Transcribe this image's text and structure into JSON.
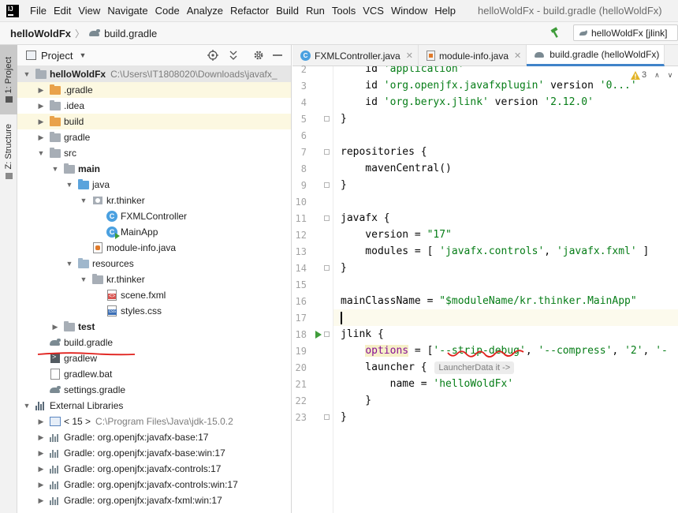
{
  "menubar": {
    "items": [
      "File",
      "Edit",
      "View",
      "Navigate",
      "Code",
      "Analyze",
      "Refactor",
      "Build",
      "Run",
      "Tools",
      "VCS",
      "Window",
      "Help"
    ],
    "window_title": "helloWoldFx - build.gradle (helloWoldFx)"
  },
  "navbar": {
    "project": "helloWoldFx",
    "file": "build.gradle",
    "run_config": "helloWoldFx [jlink]"
  },
  "toolstrip": {
    "project_tab": "1: Project",
    "structure_tab": "Z: Structure"
  },
  "project_panel": {
    "title": "Project",
    "tree": [
      {
        "label": "helloWoldFx",
        "path": "C:\\Users\\IT1808020\\Downloads\\javafx_",
        "icon": "folder-grey",
        "depth": 0,
        "open": true,
        "bold": true
      },
      {
        "label": ".gradle",
        "icon": "folder-orange",
        "depth": 1,
        "open": false
      },
      {
        "label": ".idea",
        "icon": "folder-grey",
        "depth": 1,
        "open": false
      },
      {
        "label": "build",
        "icon": "folder-orange",
        "depth": 1,
        "open": false
      },
      {
        "label": "gradle",
        "icon": "folder-grey",
        "depth": 1,
        "open": false
      },
      {
        "label": "src",
        "icon": "folder-grey",
        "depth": 1,
        "open": true
      },
      {
        "label": "main",
        "icon": "folder-grey",
        "depth": 2,
        "open": true,
        "bold": true
      },
      {
        "label": "java",
        "icon": "folder-blue",
        "depth": 3,
        "open": true
      },
      {
        "label": "kr.thinker",
        "icon": "package",
        "depth": 4,
        "open": true
      },
      {
        "label": "FXMLController",
        "icon": "class",
        "depth": 5,
        "leaf": true
      },
      {
        "label": "MainApp",
        "icon": "class-run",
        "depth": 5,
        "leaf": true
      },
      {
        "label": "module-info.java",
        "icon": "java-file",
        "depth": 4,
        "leaf": true
      },
      {
        "label": "resources",
        "icon": "folder-light",
        "depth": 3,
        "open": true
      },
      {
        "label": "kr.thinker",
        "icon": "folder-grey",
        "depth": 4,
        "open": true
      },
      {
        "label": "scene.fxml",
        "icon": "fxml-file",
        "depth": 5,
        "leaf": true
      },
      {
        "label": "styles.css",
        "icon": "css-file",
        "depth": 5,
        "leaf": true
      },
      {
        "label": "test",
        "icon": "folder-grey",
        "depth": 2,
        "open": false,
        "bold": true
      },
      {
        "label": "build.gradle",
        "icon": "gradle",
        "depth": 1,
        "leaf": true
      },
      {
        "label": "gradlew",
        "icon": "terminal",
        "depth": 1,
        "leaf": true
      },
      {
        "label": "gradlew.bat",
        "icon": "file",
        "depth": 1,
        "leaf": true
      },
      {
        "label": "settings.gradle",
        "icon": "gradle",
        "depth": 1,
        "leaf": true
      },
      {
        "label": "External Libraries",
        "icon": "bars",
        "depth": 0,
        "open": true
      },
      {
        "label": "< 15 >",
        "path": "C:\\Program Files\\Java\\jdk-15.0.2",
        "icon": "jdk",
        "depth": 1,
        "open": false
      },
      {
        "label": "Gradle: org.openjfx:javafx-base:17",
        "icon": "library",
        "depth": 1,
        "open": false
      },
      {
        "label": "Gradle: org.openjfx:javafx-base:win:17",
        "icon": "library",
        "depth": 1,
        "open": false
      },
      {
        "label": "Gradle: org.openjfx:javafx-controls:17",
        "icon": "library",
        "depth": 1,
        "open": false
      },
      {
        "label": "Gradle: org.openjfx:javafx-controls:win:17",
        "icon": "library",
        "depth": 1,
        "open": false
      },
      {
        "label": "Gradle: org.openjfx:javafx-fxml:win:17",
        "icon": "library",
        "depth": 1,
        "open": false
      }
    ]
  },
  "editor": {
    "tabs": [
      {
        "label": "FXMLController.java",
        "icon": "class"
      },
      {
        "label": "module-info.java",
        "icon": "java-file"
      },
      {
        "label": "build.gradle (helloWoldFx)",
        "icon": "gradle",
        "active": true
      }
    ],
    "warning_count": "3",
    "lines": [
      {
        "n": "2",
        "text": "    id 'application'"
      },
      {
        "n": "3",
        "text": "    id 'org.openjfx.javafxplugin' version '0...'"
      },
      {
        "n": "4",
        "text": "    id 'org.beryx.jlink' version '2.12.0'"
      },
      {
        "n": "5",
        "text": "}"
      },
      {
        "n": "6",
        "text": ""
      },
      {
        "n": "7",
        "text": "repositories {"
      },
      {
        "n": "8",
        "text": "    mavenCentral()"
      },
      {
        "n": "9",
        "text": "}"
      },
      {
        "n": "10",
        "text": ""
      },
      {
        "n": "11",
        "text": "javafx {"
      },
      {
        "n": "12",
        "text": "    version = \"17\""
      },
      {
        "n": "13",
        "text": "    modules = [ 'javafx.controls', 'javafx.fxml' ]"
      },
      {
        "n": "14",
        "text": "}"
      },
      {
        "n": "15",
        "text": ""
      },
      {
        "n": "16",
        "text": "mainClassName = \"$moduleName/kr.thinker.MainApp\""
      },
      {
        "n": "17",
        "text": ""
      },
      {
        "n": "18",
        "text": "jlink {"
      },
      {
        "n": "19",
        "text": "    options = ['--strip-debug', '--compress', '2', '-"
      },
      {
        "n": "20",
        "text": "    launcher {"
      },
      {
        "n": "21",
        "text": "        name = 'helloWoldFx'"
      },
      {
        "n": "22",
        "text": "    }"
      },
      {
        "n": "23",
        "text": "}"
      }
    ],
    "inlay_hint": "LauncherData it ->"
  },
  "colors": {
    "annotation_red": "#e0201c",
    "string_green": "#067d17",
    "keyword_purple": "#871094",
    "tab_accent": "#4083c9"
  }
}
